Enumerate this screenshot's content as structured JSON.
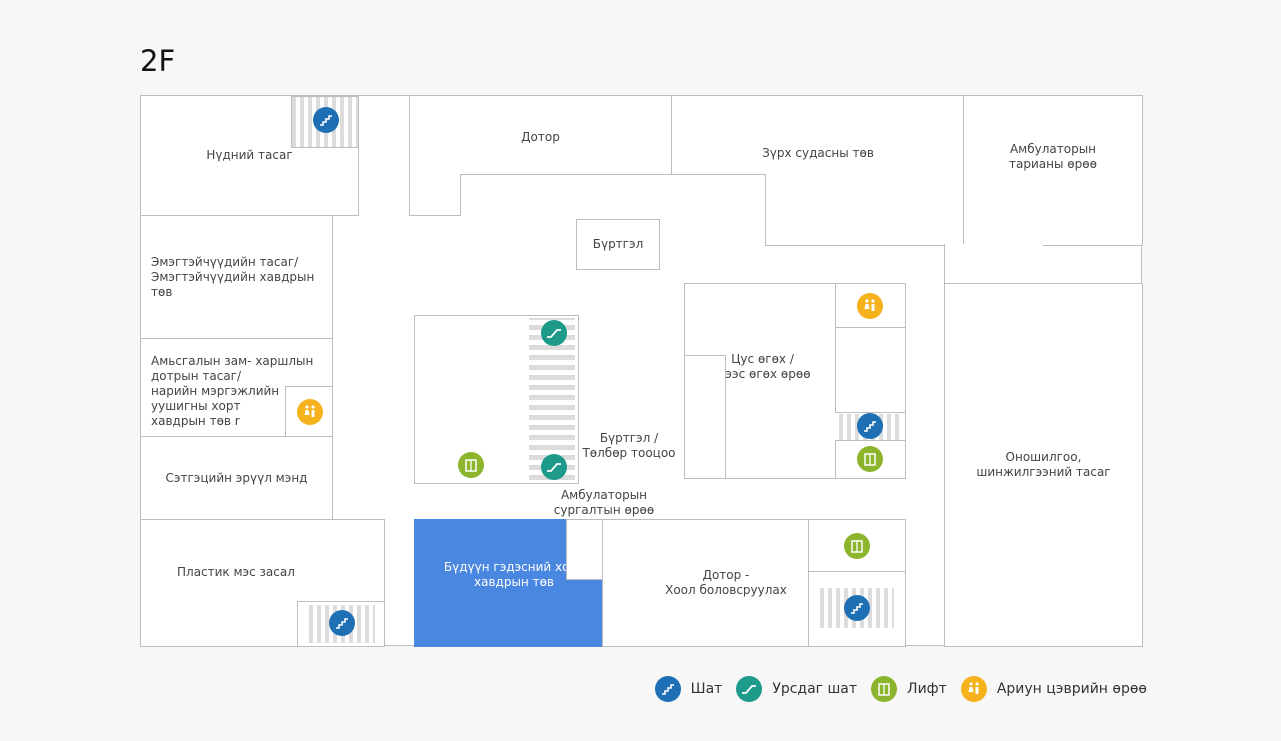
{
  "floor": "2F",
  "rooms": {
    "eye": "Нүдний тасаг",
    "internal": "Дотор",
    "cardio": "Зүрх судасны төв",
    "vaccine": "Амбулаторын\nтарианы өрөө",
    "registration": "Бүртгэл",
    "gyn": "Эмэгтэйчүүдийн тасаг/\nЭмэгтэйчүүдийн хавдрын төв",
    "respiratory": "Амьсгалын зам- харшлын\nдотрын тасаг/\nнарийн мэргэжлийн\nуушигны хорт\nхавдрын төв r",
    "blood": "Цус өгөх /\nшээс өгөх өрөө",
    "diagnostics": "Оношилгоо,\nшинжилгээний тасаг",
    "mental": "Сэтгэцийн эрүүл мэнд",
    "plastic": "Пластик мэс засал",
    "gastro": "Бүдүүн гэдэсний хорт\nхавдрын төв",
    "internal_gi": "Дотор -\nХоол боловсруулах"
  },
  "labels": {
    "reg_payment": "Бүртгэл /\nТөлбөр тооцоо",
    "training": "Амбулаторын\nсургалтын өрөө"
  },
  "legend": [
    {
      "icon": "stairs-icon",
      "label": "Шат",
      "color": "#1f6fb5"
    },
    {
      "icon": "escalator-icon",
      "label": "Урсдаг шат",
      "color": "#1d9a8a"
    },
    {
      "icon": "elevator-icon",
      "label": "Лифт",
      "color": "#8cb52d"
    },
    {
      "icon": "restroom-icon",
      "label": "Ариун цэврийн өрөө",
      "color": "#f5b21c"
    }
  ]
}
